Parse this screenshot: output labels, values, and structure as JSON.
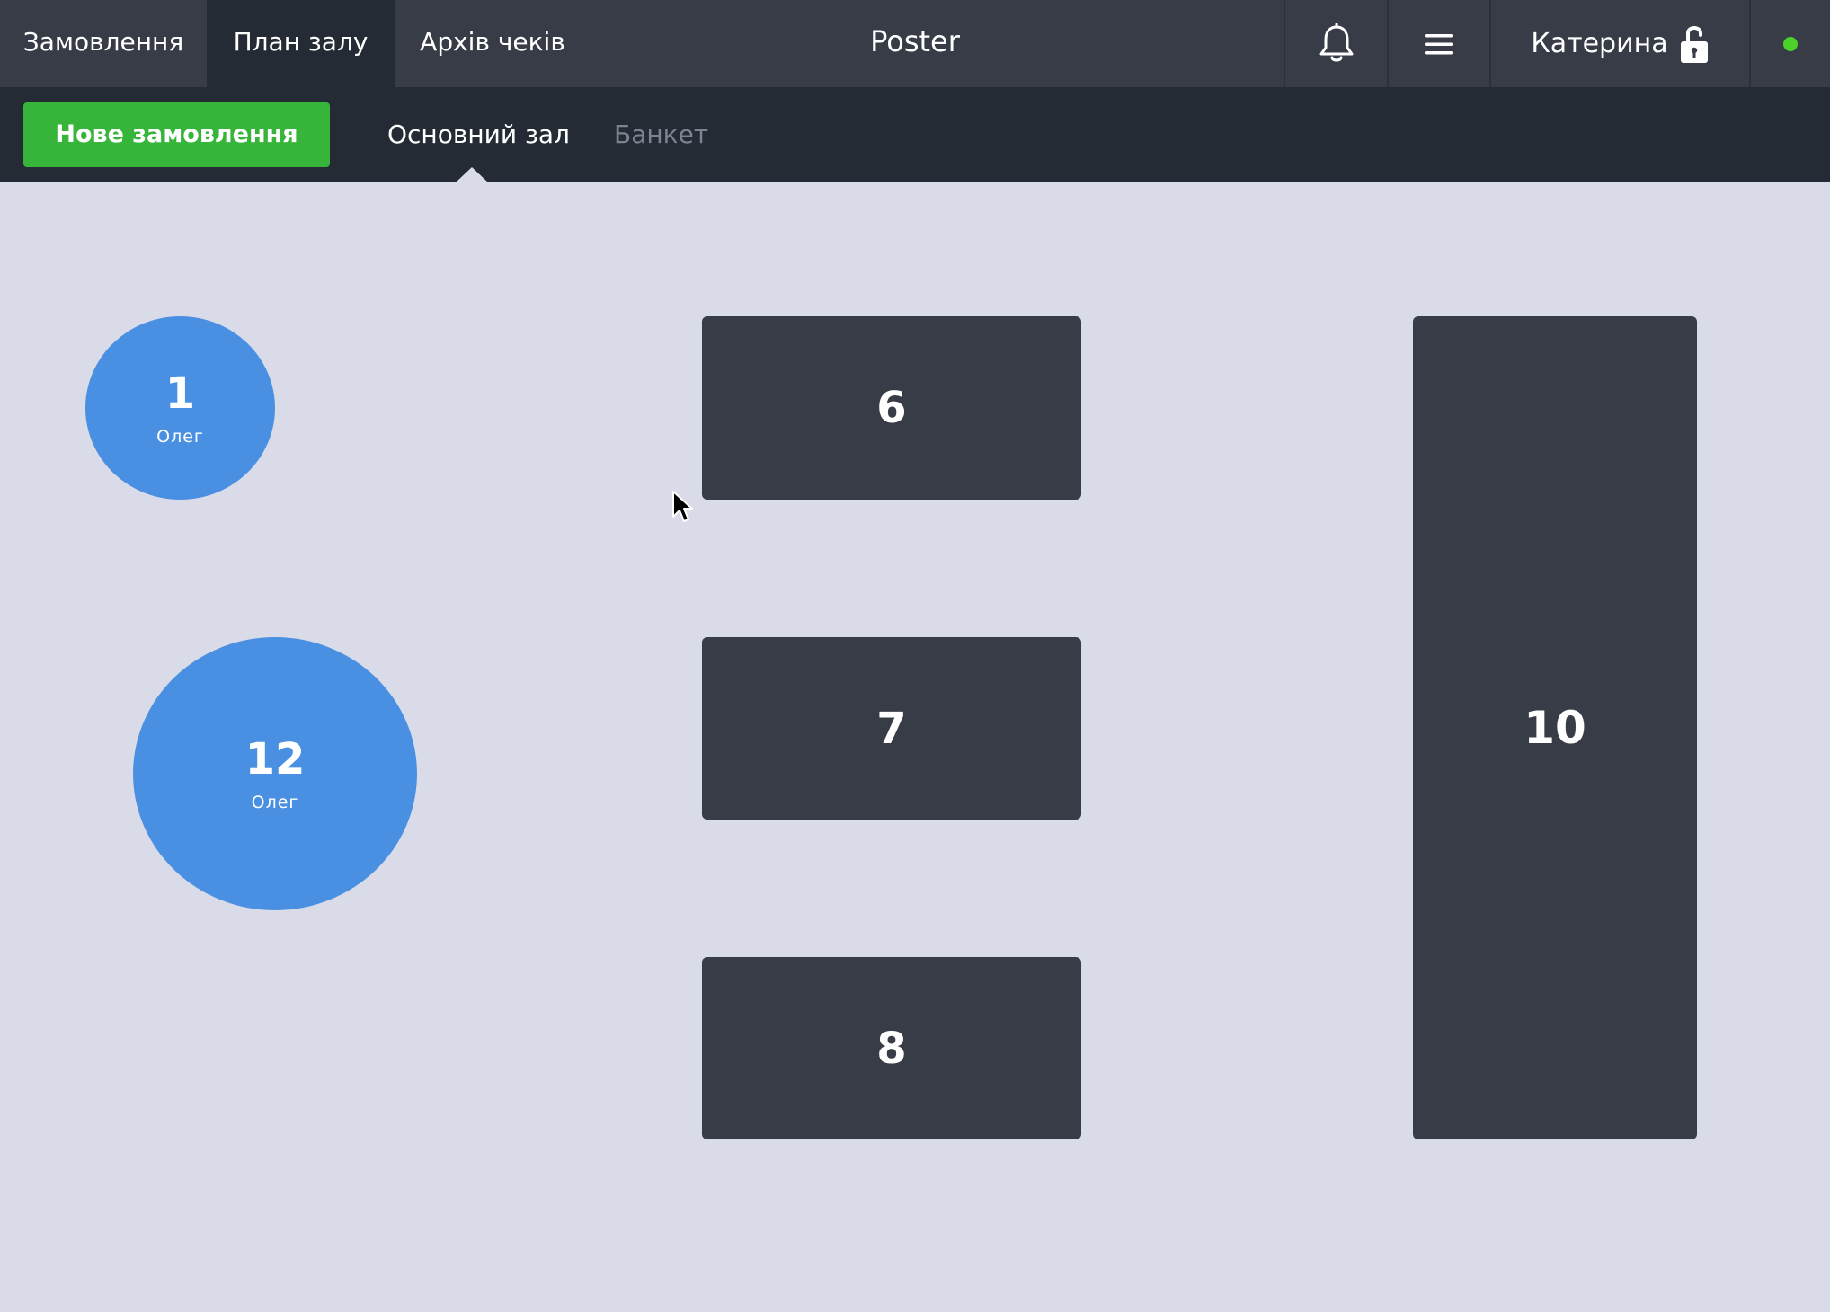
{
  "top_nav": {
    "tabs": [
      {
        "label": "Замовлення",
        "active": false
      },
      {
        "label": "План залу",
        "active": true
      },
      {
        "label": "Архів чеків",
        "active": false
      }
    ],
    "app_title": "Poster",
    "user_name": "Катерина",
    "icons": {
      "notifications": "bell-icon",
      "menu": "hamburger-menu-icon",
      "lock": "unlocked-padlock-icon",
      "status": "online-status-dot"
    },
    "status_color": "#4cd02a"
  },
  "sub_nav": {
    "new_order_label": "Нове замовлення",
    "halls": [
      {
        "label": "Основний зал",
        "active": true
      },
      {
        "label": "Банкет",
        "active": false
      }
    ]
  },
  "tables": [
    {
      "number": "1",
      "shape": "round",
      "waiter": "Олег",
      "occupied": true
    },
    {
      "number": "12",
      "shape": "round",
      "waiter": "Олег",
      "occupied": true
    },
    {
      "number": "6",
      "shape": "rect",
      "waiter": "",
      "occupied": false
    },
    {
      "number": "7",
      "shape": "rect",
      "waiter": "",
      "occupied": false
    },
    {
      "number": "8",
      "shape": "rect",
      "waiter": "",
      "occupied": false
    },
    {
      "number": "10",
      "shape": "rect",
      "waiter": "",
      "occupied": false
    }
  ],
  "colors": {
    "top_bar": "#373c47",
    "sub_bar": "#252b35",
    "floor": "#d9dbe8",
    "occupied_table": "#4a90e2",
    "free_table": "#373c47",
    "primary_button": "#37b53a"
  }
}
